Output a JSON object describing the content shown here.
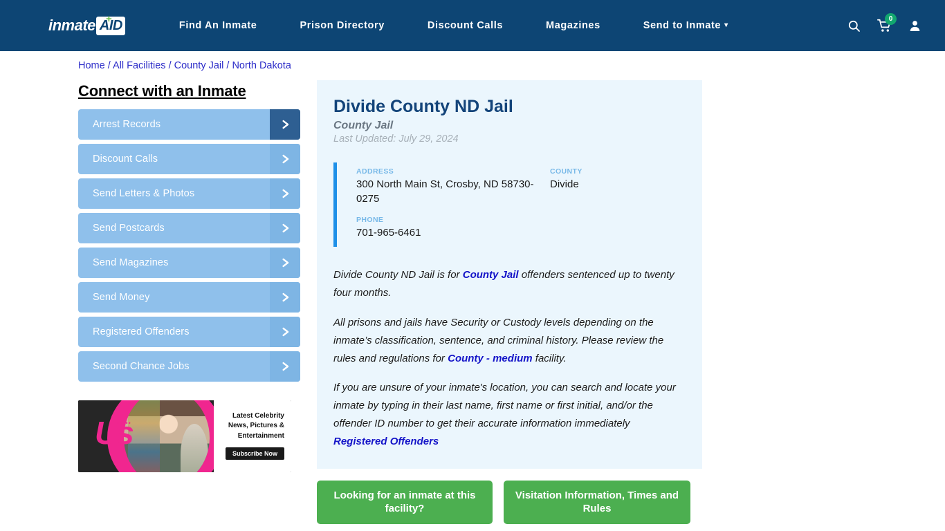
{
  "header": {
    "logo": {
      "word": "inmate",
      "plus": "+",
      "aid": "AID"
    },
    "nav": [
      {
        "label": "Find An Inmate",
        "caret": false
      },
      {
        "label": "Prison Directory",
        "caret": false
      },
      {
        "label": "Discount Calls",
        "caret": false
      },
      {
        "label": "Magazines",
        "caret": false
      },
      {
        "label": "Send to Inmate",
        "caret": true
      }
    ],
    "caret_glyph": "▾",
    "cart_count": "0",
    "colors": {
      "bar": "#0d4574",
      "badge": "#12a66f",
      "plus": "#6cc04a"
    }
  },
  "breadcrumb": {
    "items": [
      "Home",
      "All Facilities",
      "County Jail",
      "North Dakota"
    ],
    "separator": "/"
  },
  "sidebar": {
    "title": "Connect with an Inmate",
    "arrow_glyph": "›",
    "items": [
      {
        "label": "Arrest Records",
        "active": true
      },
      {
        "label": "Discount Calls",
        "active": false
      },
      {
        "label": "Send Letters & Photos",
        "active": false
      },
      {
        "label": "Send Postcards",
        "active": false
      },
      {
        "label": "Send Magazines",
        "active": false
      },
      {
        "label": "Send Money",
        "active": false
      },
      {
        "label": "Registered Offenders",
        "active": false
      },
      {
        "label": "Second Chance Jobs",
        "active": false
      }
    ]
  },
  "ad": {
    "brand": "Us",
    "dots": "•••••",
    "headline": "Latest Celebrity News, Pictures & Entertainment",
    "cta": "Subscribe Now"
  },
  "facility": {
    "name": "Divide County ND Jail",
    "type": "County Jail",
    "updated": "Last Updated: July 29, 2024",
    "address_label": "ADDRESS",
    "address_value": "300 North Main St, Crosby, ND 58730-0275",
    "county_label": "COUNTY",
    "county_value": "Divide",
    "phone_label": "PHONE",
    "phone_value": "701-965-6461"
  },
  "description": {
    "p1_a": "Divide County ND Jail is for ",
    "p1_link": "County Jail",
    "p1_b": " offenders sentenced up to twenty four months.",
    "p2_a": "All prisons and jails have Security or Custody levels depending on the inmate’s classification, sentence, and criminal history. Please review the rules and regulations for ",
    "p2_link": "County - medium",
    "p2_b": " facility.",
    "p3": "If you are unsure of your inmate's location, you can search and locate your inmate by typing in their last name, first name or first initial, and/or the offender ID number to get their accurate information immediately",
    "p3_link": "Registered Offenders"
  },
  "cta_buttons": [
    {
      "label": "Looking for an inmate at this facility?"
    },
    {
      "label": "Visitation Information, Times and Rules"
    }
  ]
}
